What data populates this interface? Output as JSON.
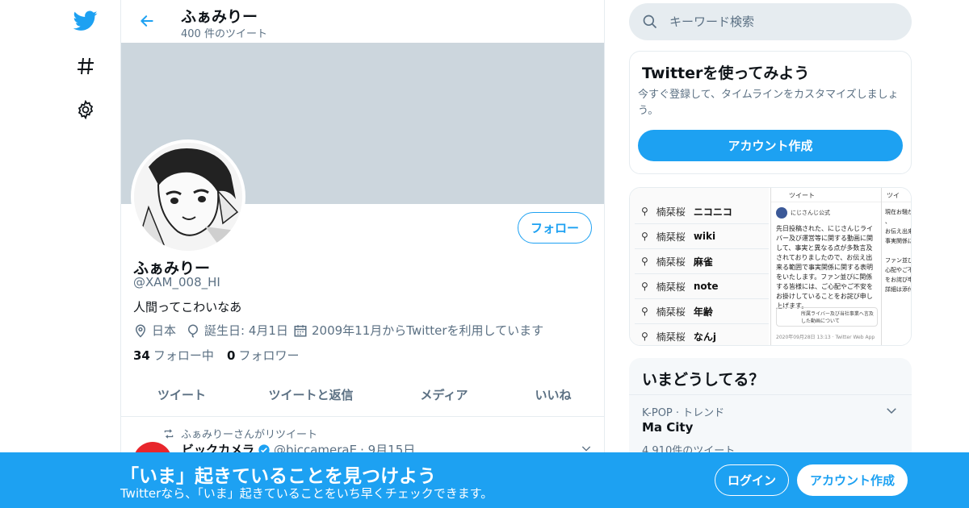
{
  "nav": {
    "logo_icon": "twitter-bird-icon",
    "explore_icon": "hashtag-icon",
    "settings_icon": "gear-icon"
  },
  "header": {
    "title": "ふぁみりー",
    "subtitle": "400 件のツイート"
  },
  "profile": {
    "name": "ふぁみりー",
    "handle": "@XAM_008_HI",
    "bio": "人間ってこわいなあ",
    "location": "日本",
    "birthday": "誕生日: 4月1日",
    "joined": "2009年11月からTwitterを利用しています",
    "following_count": "34",
    "following_label": "フォロー中",
    "followers_count": "0",
    "followers_label": "フォロワー",
    "follow_button": "フォロー"
  },
  "tabs": [
    "ツイート",
    "ツイートと返信",
    "メディア",
    "いいね"
  ],
  "tweet": {
    "retweet_label": "ふぁみりーさんがリツイート",
    "author": "ビックカメラ",
    "handle": "@biccameraE",
    "date": "· 9月15日"
  },
  "search": {
    "placeholder": "キーワード検索"
  },
  "signup_card": {
    "title": "Twitterを使ってみよう",
    "description": "今すぐ登録して、タイムラインをカスタマイズしましょう。",
    "button": "アカウント作成"
  },
  "media_card": {
    "suggestions": [
      {
        "prefix": "楠栞桜",
        "term": "ニコニコ"
      },
      {
        "prefix": "楠栞桜",
        "term": "wiki"
      },
      {
        "prefix": "楠栞桜",
        "term": "麻雀"
      },
      {
        "prefix": "楠栞桜",
        "term": "note"
      },
      {
        "prefix": "楠栞桜",
        "term": "年齢"
      },
      {
        "prefix": "楠栞桜",
        "term": "なんj"
      }
    ],
    "mid_header": "ツイート",
    "mid_account": "にじさんじ公式",
    "mid_text": "先日投稿された、にじさんじライバー及び運営等に関する動画に関して、事実と異なる点が多数言及されておりましたので、お伝え出来る範囲で事実関係に関する表明をいたします。ファン並びに関係する皆様には、ご心配やご不安をお掛けしていることをお詫び申し上げます。",
    "mid_link": "所属ライバー及び当社事業へ言及した動画について",
    "mid_footer": "2020年09月28日 13:13 · Twitter Web App",
    "right_header": "ツイ",
    "right_text": [
      "現在お騒が",
      "、",
      "お伝え出来",
      "事実関係に",
      "",
      "ファン並び",
      "心配やご不",
      "をお詫び申",
      "詳細は添付"
    ]
  },
  "trends": {
    "title": "いまどうしてる？",
    "items": [
      {
        "category": "K-POP · トレンド",
        "name": "Ma City",
        "count": "4,910件のツイート"
      }
    ]
  },
  "bottom_bar": {
    "title": "「いま」起きていることを見つけよう",
    "subtitle": "Twitterなら、「いま」起きていることをいち早くチェックできます。",
    "login": "ログイン",
    "signup": "アカウント作成"
  },
  "colors": {
    "accent": "#1da1f2",
    "banner": "#ccd6dd",
    "secondary_text": "#5b7083"
  }
}
